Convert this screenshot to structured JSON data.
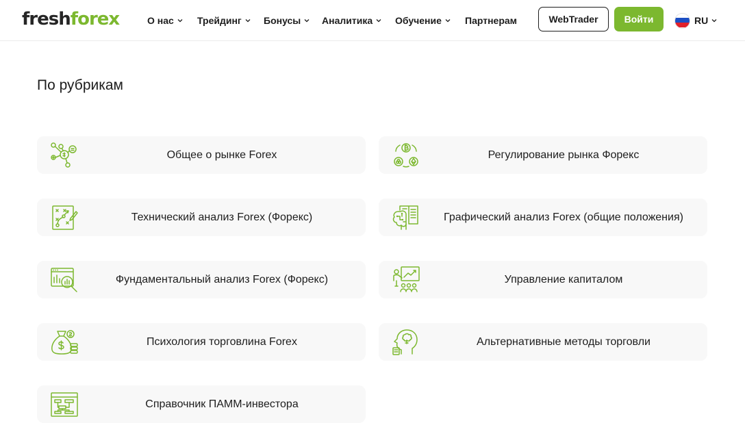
{
  "header": {
    "logo": {
      "part1": "fresh",
      "part2": "forex"
    },
    "nav": [
      {
        "label": "О нас",
        "has_dropdown": true
      },
      {
        "label": "Трейдинг",
        "has_dropdown": true
      },
      {
        "label": "Бонусы",
        "has_dropdown": true
      },
      {
        "label": "Аналитика",
        "has_dropdown": true
      },
      {
        "label": "Обучение",
        "has_dropdown": true
      },
      {
        "label": "Партнерам",
        "has_dropdown": false
      }
    ],
    "webtrader_label": "WebTrader",
    "login_label": "Войти",
    "language": {
      "code": "RU",
      "flag": "russia-flag"
    }
  },
  "colors": {
    "accent": "#7cb82f",
    "card_bg": "#f8f8f8",
    "text": "#1d1d1d"
  },
  "main": {
    "section_title": "По рубрикам",
    "categories": [
      {
        "label": "Общее о рынке Forex",
        "icon": "network-finance-icon"
      },
      {
        "label": "Регулирование рынка Форекс",
        "icon": "crypto-coins-icon"
      },
      {
        "label": "Технический анализ Forex (Форекс)",
        "icon": "strategy-plan-icon"
      },
      {
        "label": "Графический анализ Forex (общие положения)",
        "icon": "brain-book-icon"
      },
      {
        "label": "Фундаментальный анализ Forex (Форекс)",
        "icon": "chart-magnifier-icon"
      },
      {
        "label": "Управление капиталом",
        "icon": "presentation-icon"
      },
      {
        "label": "Психология торговлина Forex",
        "icon": "money-bag-icon"
      },
      {
        "label": "Альтернативные методы торговли",
        "icon": "head-thinking-icon"
      },
      {
        "label": "Справочник ПАММ-инвестора",
        "icon": "flowchart-icon"
      }
    ]
  }
}
